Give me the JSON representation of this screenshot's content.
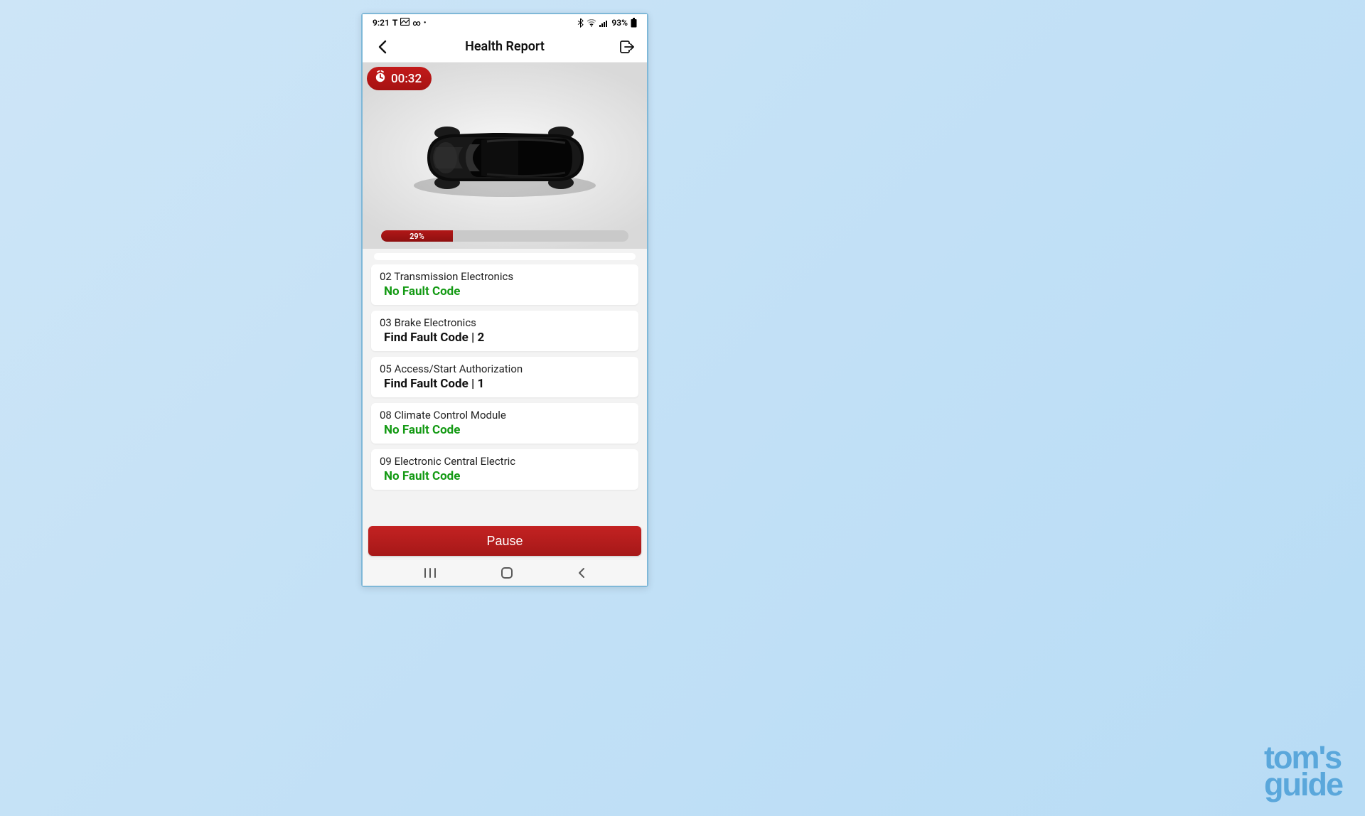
{
  "status_bar": {
    "time": "9:21",
    "battery": "93%"
  },
  "header": {
    "title": "Health Report"
  },
  "timer": {
    "elapsed": "00:32"
  },
  "progress": {
    "percent": 29,
    "label": "29%"
  },
  "modules": [
    {
      "name": "02 Transmission Electronics",
      "status": "No Fault Code",
      "ok": true
    },
    {
      "name": "03 Brake Electronics",
      "status": "Find Fault Code | 2",
      "ok": false
    },
    {
      "name": "05 Access/Start Authorization",
      "status": "Find Fault Code | 1",
      "ok": false
    },
    {
      "name": "08 Climate Control Module",
      "status": "No Fault Code",
      "ok": true
    },
    {
      "name": "09 Electronic Central Electric",
      "status": "No Fault Code",
      "ok": true
    }
  ],
  "buttons": {
    "pause": "Pause"
  },
  "watermark": {
    "line1": "tom's",
    "line2": "guide"
  },
  "colors": {
    "accent_red": "#b11717",
    "ok_green": "#149a14"
  }
}
